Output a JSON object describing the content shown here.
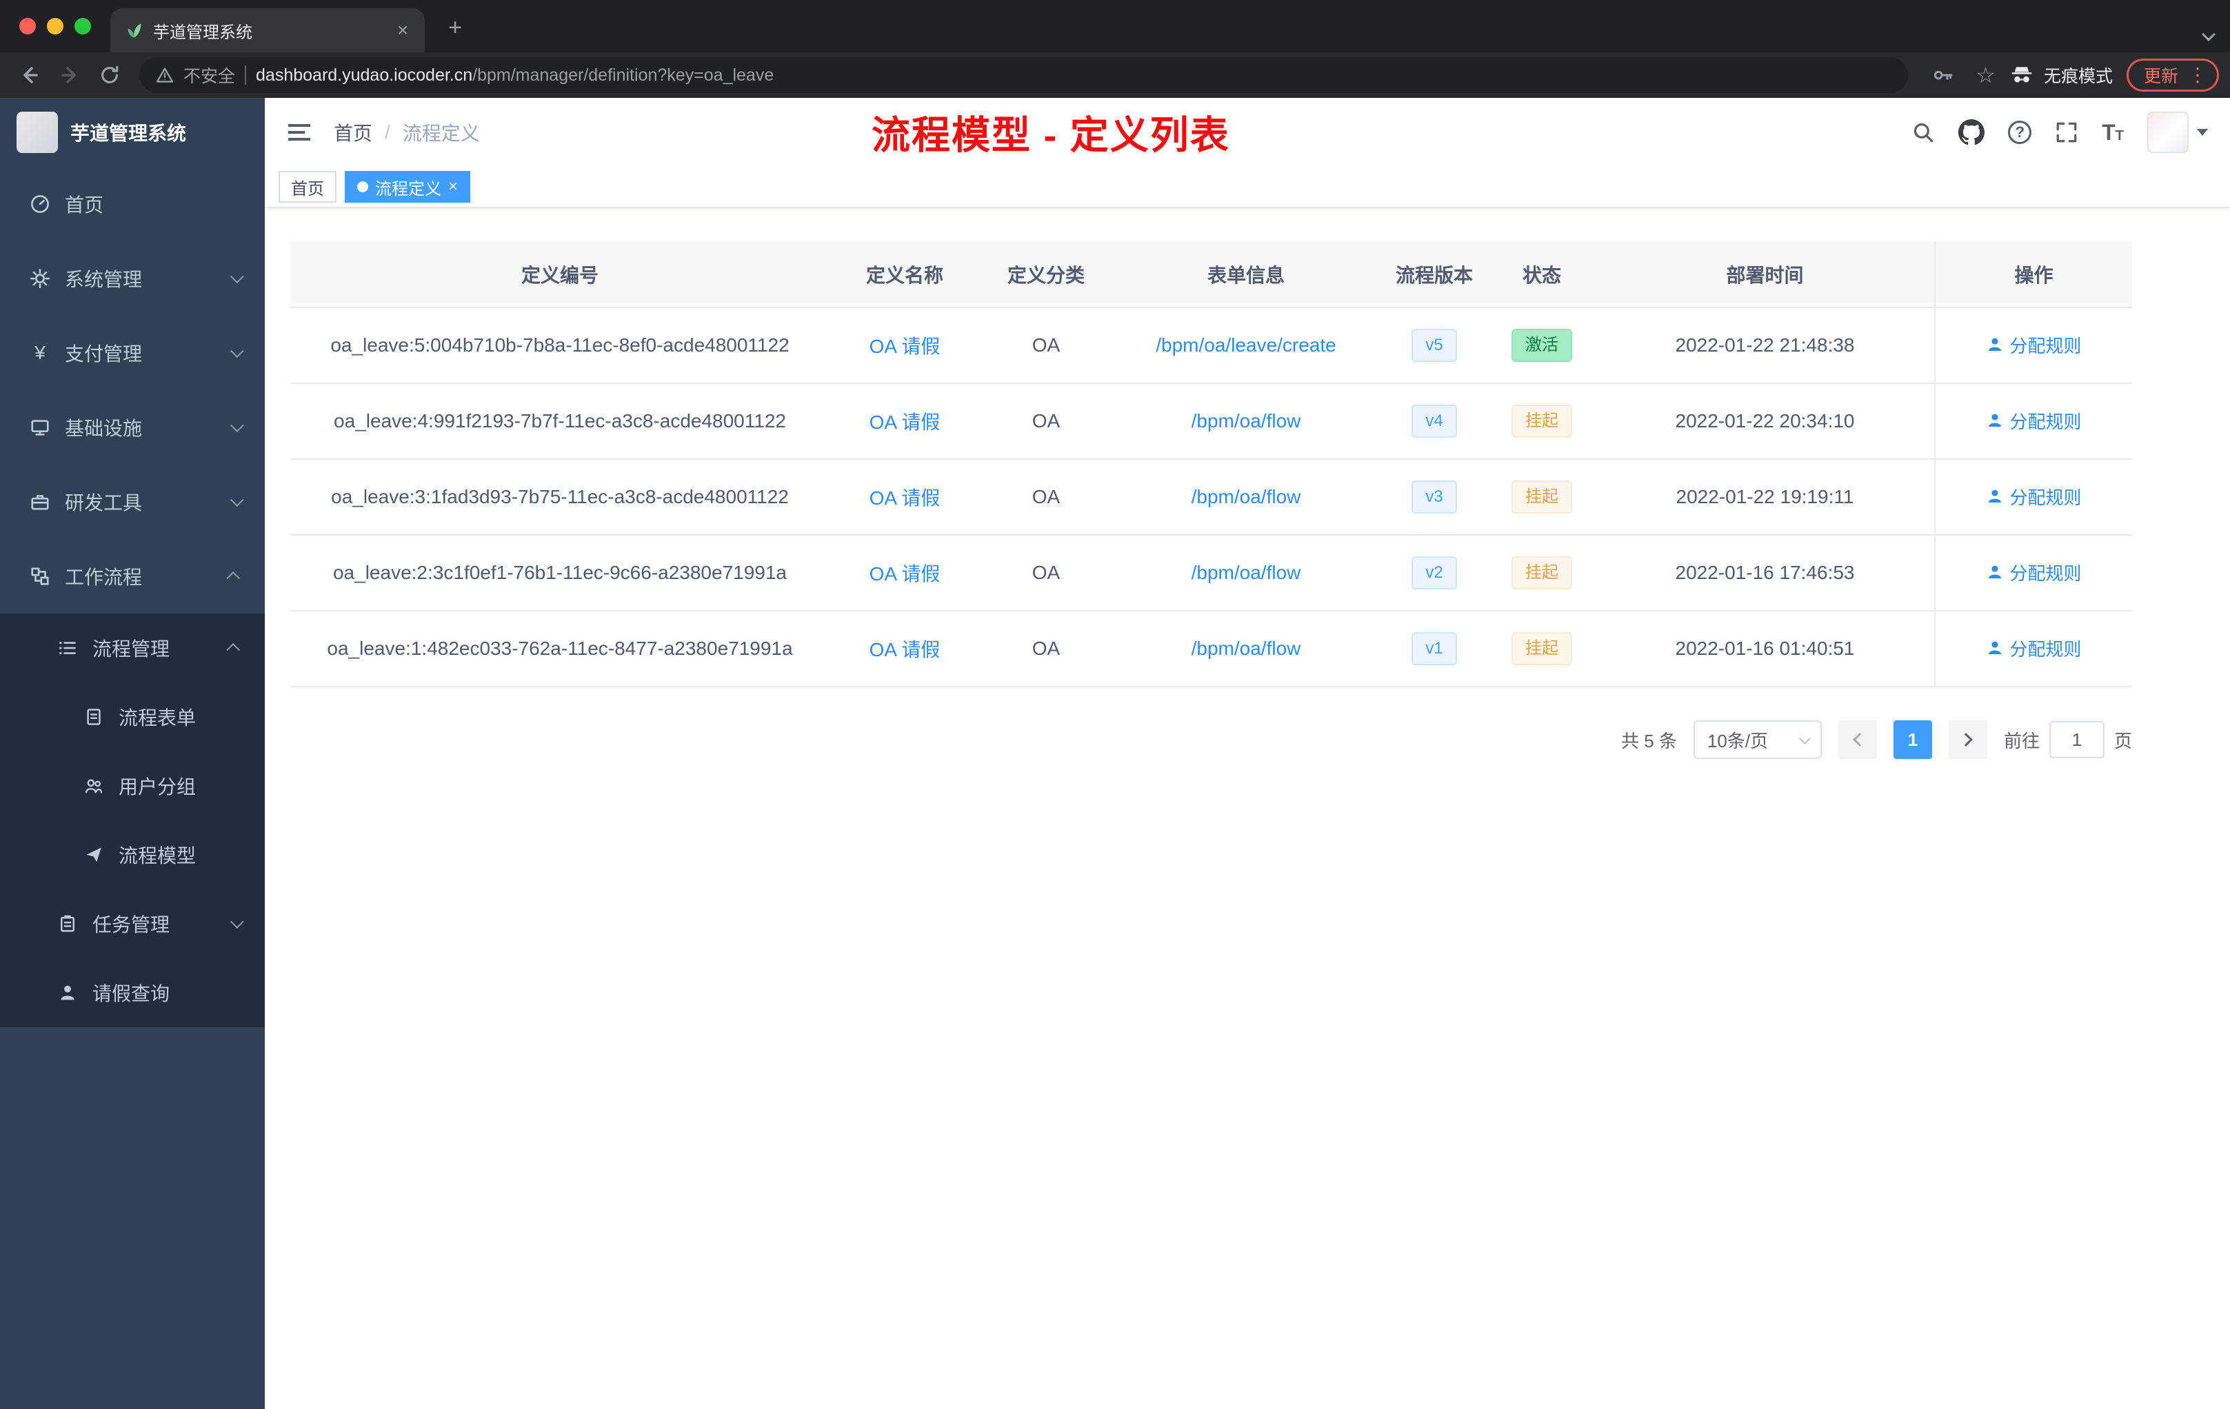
{
  "browser": {
    "tab_title": "芋道管理系统",
    "new_tab": "+",
    "security_label": "不安全",
    "url_host": "dashboard.yudao.iocoder.cn",
    "url_path": "/bpm/manager/definition?key=oa_leave",
    "incognito_label": "无痕模式",
    "update_label": "更新"
  },
  "sidebar": {
    "app_title": "芋道管理系统",
    "items": [
      {
        "label": "首页"
      },
      {
        "label": "系统管理"
      },
      {
        "label": "支付管理"
      },
      {
        "label": "基础设施"
      },
      {
        "label": "研发工具"
      },
      {
        "label": "工作流程"
      }
    ],
    "process_menu": {
      "label": "流程管理",
      "children": [
        {
          "label": "流程表单"
        },
        {
          "label": "用户分组"
        },
        {
          "label": "流程模型"
        }
      ]
    },
    "task_menu": {
      "label": "任务管理"
    },
    "leave_item": {
      "label": "请假查询"
    }
  },
  "header": {
    "breadcrumb_home": "首页",
    "breadcrumb_current": "流程定义",
    "annotation": "流程模型 - 定义列表"
  },
  "tags": {
    "home": "首页",
    "active": "流程定义"
  },
  "table": {
    "columns": [
      "定义编号",
      "定义名称",
      "定义分类",
      "表单信息",
      "流程版本",
      "状态",
      "部署时间",
      "操作"
    ],
    "rows": [
      {
        "id": "oa_leave:5:004b710b-7b8a-11ec-8ef0-acde48001122",
        "name": "OA 请假",
        "category": "OA",
        "form": "/bpm/oa/leave/create",
        "version": "v5",
        "status": "激活",
        "status_type": "success",
        "deploy_time": "2022-01-22 21:48:38",
        "action": "分配规则"
      },
      {
        "id": "oa_leave:4:991f2193-7b7f-11ec-a3c8-acde48001122",
        "name": "OA 请假",
        "category": "OA",
        "form": "/bpm/oa/flow",
        "version": "v4",
        "status": "挂起",
        "status_type": "warning",
        "deploy_time": "2022-01-22 20:34:10",
        "action": "分配规则"
      },
      {
        "id": "oa_leave:3:1fad3d93-7b75-11ec-a3c8-acde48001122",
        "name": "OA 请假",
        "category": "OA",
        "form": "/bpm/oa/flow",
        "version": "v3",
        "status": "挂起",
        "status_type": "warning",
        "deploy_time": "2022-01-22 19:19:11",
        "action": "分配规则"
      },
      {
        "id": "oa_leave:2:3c1f0ef1-76b1-11ec-9c66-a2380e71991a",
        "name": "OA 请假",
        "category": "OA",
        "form": "/bpm/oa/flow",
        "version": "v2",
        "status": "挂起",
        "status_type": "warning",
        "deploy_time": "2022-01-16 17:46:53",
        "action": "分配规则"
      },
      {
        "id": "oa_leave:1:482ec033-762a-11ec-8477-a2380e71991a",
        "name": "OA 请假",
        "category": "OA",
        "form": "/bpm/oa/flow",
        "version": "v1",
        "status": "挂起",
        "status_type": "warning",
        "deploy_time": "2022-01-16 01:40:51",
        "action": "分配规则"
      }
    ]
  },
  "pagination": {
    "total": "共 5 条",
    "page_size": "10条/页",
    "current_page": "1",
    "goto_label": "前往",
    "goto_value": "1",
    "goto_unit": "页"
  },
  "colors": {
    "accent_blue": "#409eff",
    "link_blue": "#2d8cf0",
    "success_green": "#13ce66",
    "warning_orange": "#e6a23c",
    "annotation_red": "#f50d0d",
    "sidebar_bg": "#304156",
    "submenu_bg": "#1f2d3d"
  }
}
